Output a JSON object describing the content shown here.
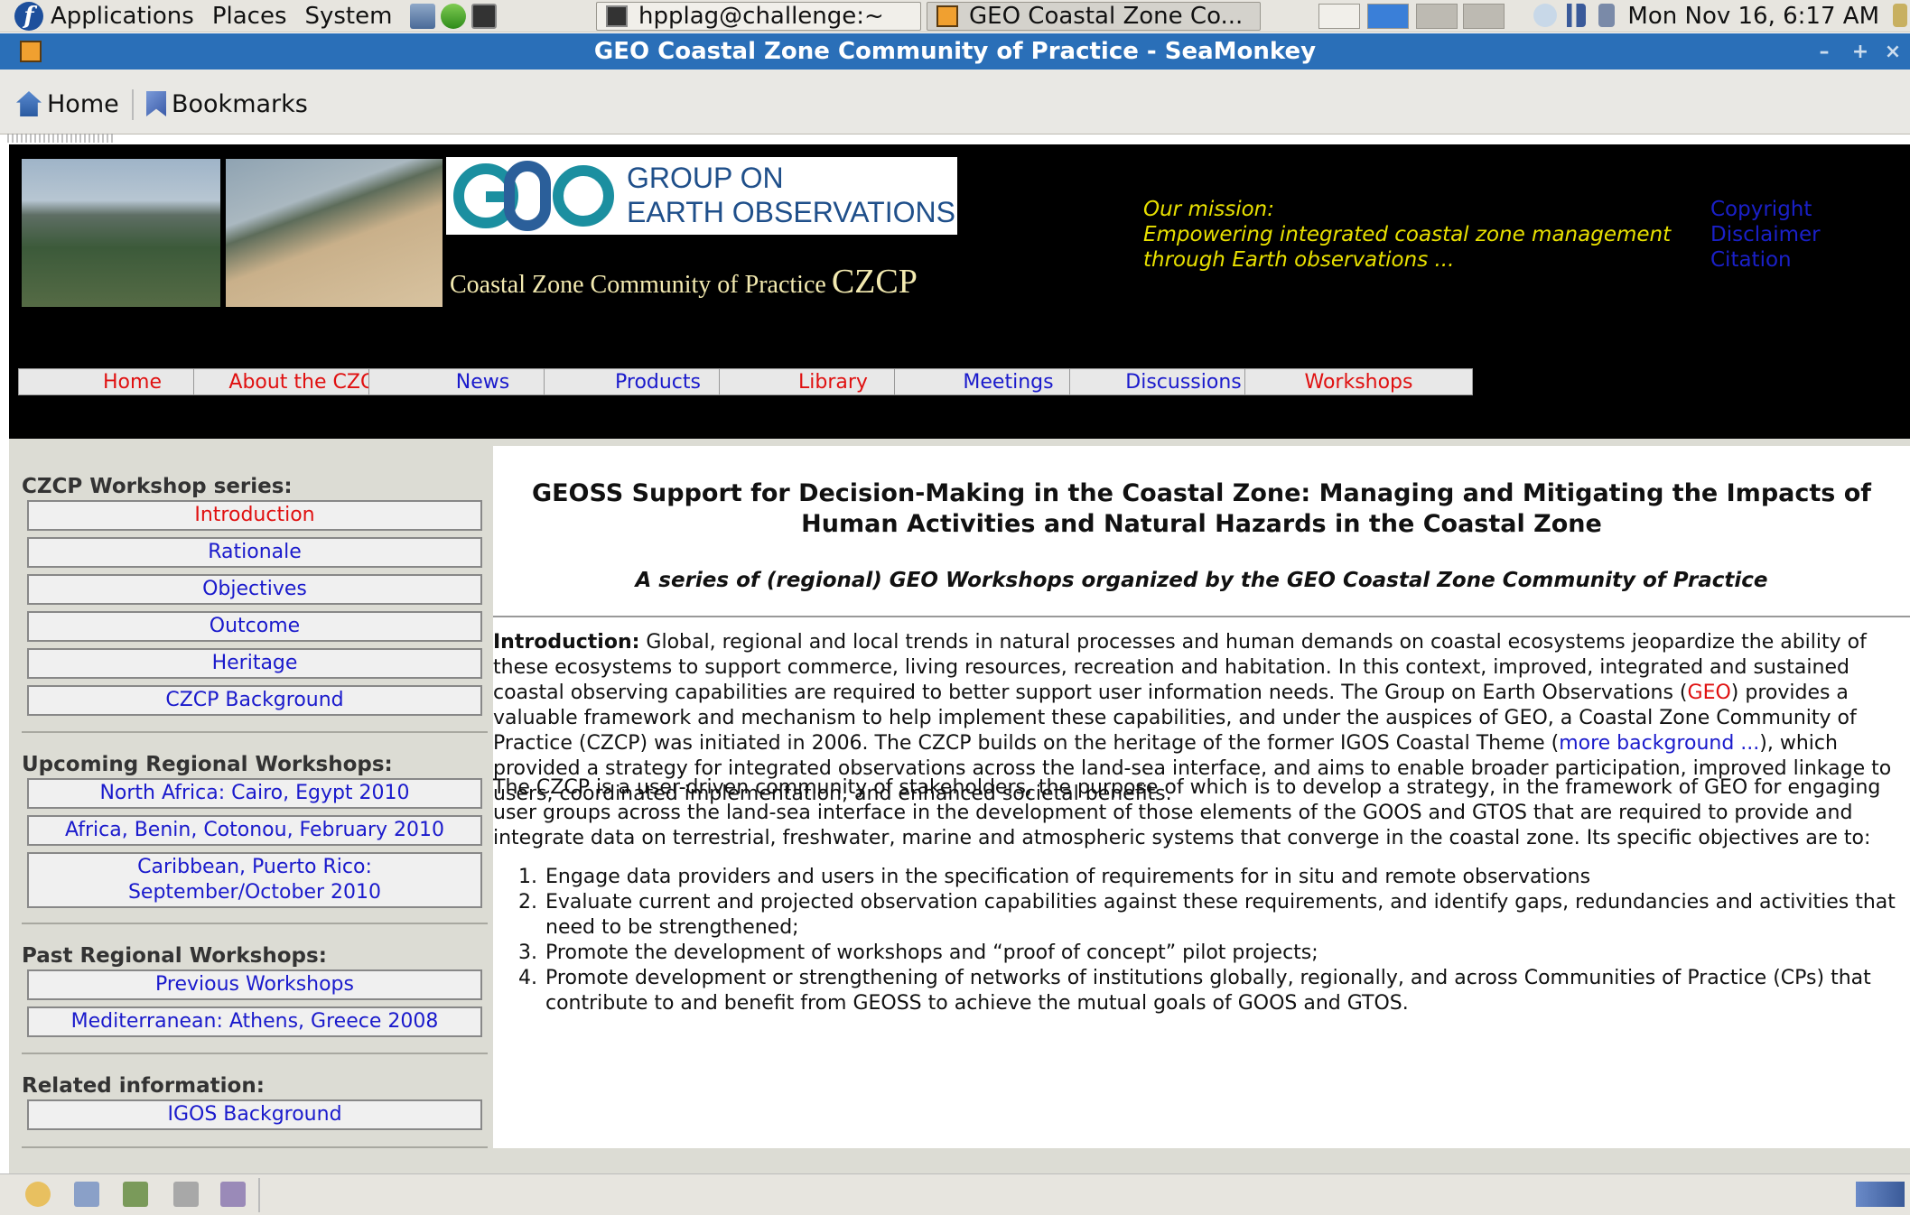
{
  "panel": {
    "menus": [
      "Applications",
      "Places",
      "System"
    ],
    "tasks": [
      "hpplag@challenge:~",
      "GEO Coastal Zone Co..."
    ],
    "clock": "Mon Nov 16,  6:17 AM"
  },
  "window": {
    "title": "GEO Coastal Zone Community of Practice - SeaMonkey",
    "buttons": [
      "–",
      "+",
      "×"
    ]
  },
  "toolbar": {
    "home_label": "Home",
    "bookmarks_label": "Bookmarks"
  },
  "header": {
    "geo_line1": "GROUP ON",
    "geo_line2": "EARTH OBSERVATIONS",
    "czcp_text": "Coastal Zone Community of Practice",
    "czcp_big": "CZCP",
    "mission_label": "Our mission:",
    "mission_line1": "Empowering integrated coastal zone management",
    "mission_line2": "through Earth observations ...",
    "links": [
      "Copyright",
      "Disclaimer",
      "Citation"
    ],
    "colors": {
      "mission": "#e8e000",
      "link": "#1a20c8",
      "nav_active": "#e01010",
      "nav_link": "#1a1acc"
    }
  },
  "nav": [
    {
      "label": "Home",
      "active": true
    },
    {
      "label": "About the CZCP",
      "active": true
    },
    {
      "label": "News",
      "active": false
    },
    {
      "label": "Products",
      "active": false
    },
    {
      "label": "Library",
      "active": true
    },
    {
      "label": "Meetings",
      "active": false
    },
    {
      "label": "Discussions",
      "active": false
    },
    {
      "label": "Workshops",
      "active": true
    }
  ],
  "sidebar": {
    "series_heading": "CZCP Workshop series:",
    "series": [
      "Introduction",
      "Rationale",
      "Objectives",
      "Outcome",
      "Heritage",
      "CZCP Background"
    ],
    "upcoming_heading": "Upcoming Regional Workshops:",
    "upcoming": [
      "North Africa: Cairo, Egypt 2010",
      "Africa, Benin, Cotonou, February 2010",
      "Caribbean, Puerto Rico:",
      "September/October 2010"
    ],
    "past_heading": "Past Regional Workshops:",
    "past": [
      "Previous Workshops",
      "Mediterranean: Athens, Greece 2008"
    ],
    "related_heading": "Related information:",
    "related": [
      "IGOS Background"
    ]
  },
  "content": {
    "title_line1": "GEOSS Support for Decision-Making in the Coastal Zone: Managing and Mitigating the Impacts of",
    "title_line2": "Human Activities and Natural Hazards in the Coastal Zone",
    "subtitle": "A series of (regional) GEO Workshops organized by the GEO Coastal Zone Community of Practice",
    "intro_label": "Introduction:",
    "intro_a": " Global, regional and local trends in natural processes and human demands on coastal ecosystems jeopardize the ability of these ecosystems to support commerce, living resources, recreation and habitation. In this context, improved, integrated and sustained coastal observing capabilities are required to better support user information needs. The Group on Earth Observations (",
    "intro_geo": "GEO",
    "intro_b": ") provides a valuable framework and mechanism to help implement these capabilities, and under the auspices of GEO, a Coastal Zone Community of Practice (CZCP) was initiated in 2006. The CZCP builds on the heritage of the former IGOS Coastal Theme (",
    "intro_more": "more background ...",
    "intro_c": "), which provided a strategy for integrated observations across the land-sea interface, and aims to enable broader participation, improved linkage to users, coordinated implementation, and enhanced societal benefits.",
    "para2": "The CZCP is a user-driven community of stakeholders, the purpose of which is to develop a strategy, in the framework of GEO for engaging user groups across the land-sea interface in the development of those elements of the GOOS and GTOS that are required to provide and integrate data on terrestrial, freshwater, marine and atmospheric systems that converge in the coastal zone. Its specific objectives are to:",
    "objectives": [
      "Engage data providers and users in the specification of requirements for in situ and remote observations",
      "Evaluate current and projected observation capabilities against these requirements, and identify gaps, redundancies and activities that need to be strengthened;",
      "Promote the development of workshops and “proof of concept” pilot projects;",
      "Promote development or strengthening of networks of institutions globally, regionally, and across Communities of Practice (CPs) that contribute to and benefit from GEOSS to achieve the mutual goals of GOOS and GTOS."
    ]
  }
}
